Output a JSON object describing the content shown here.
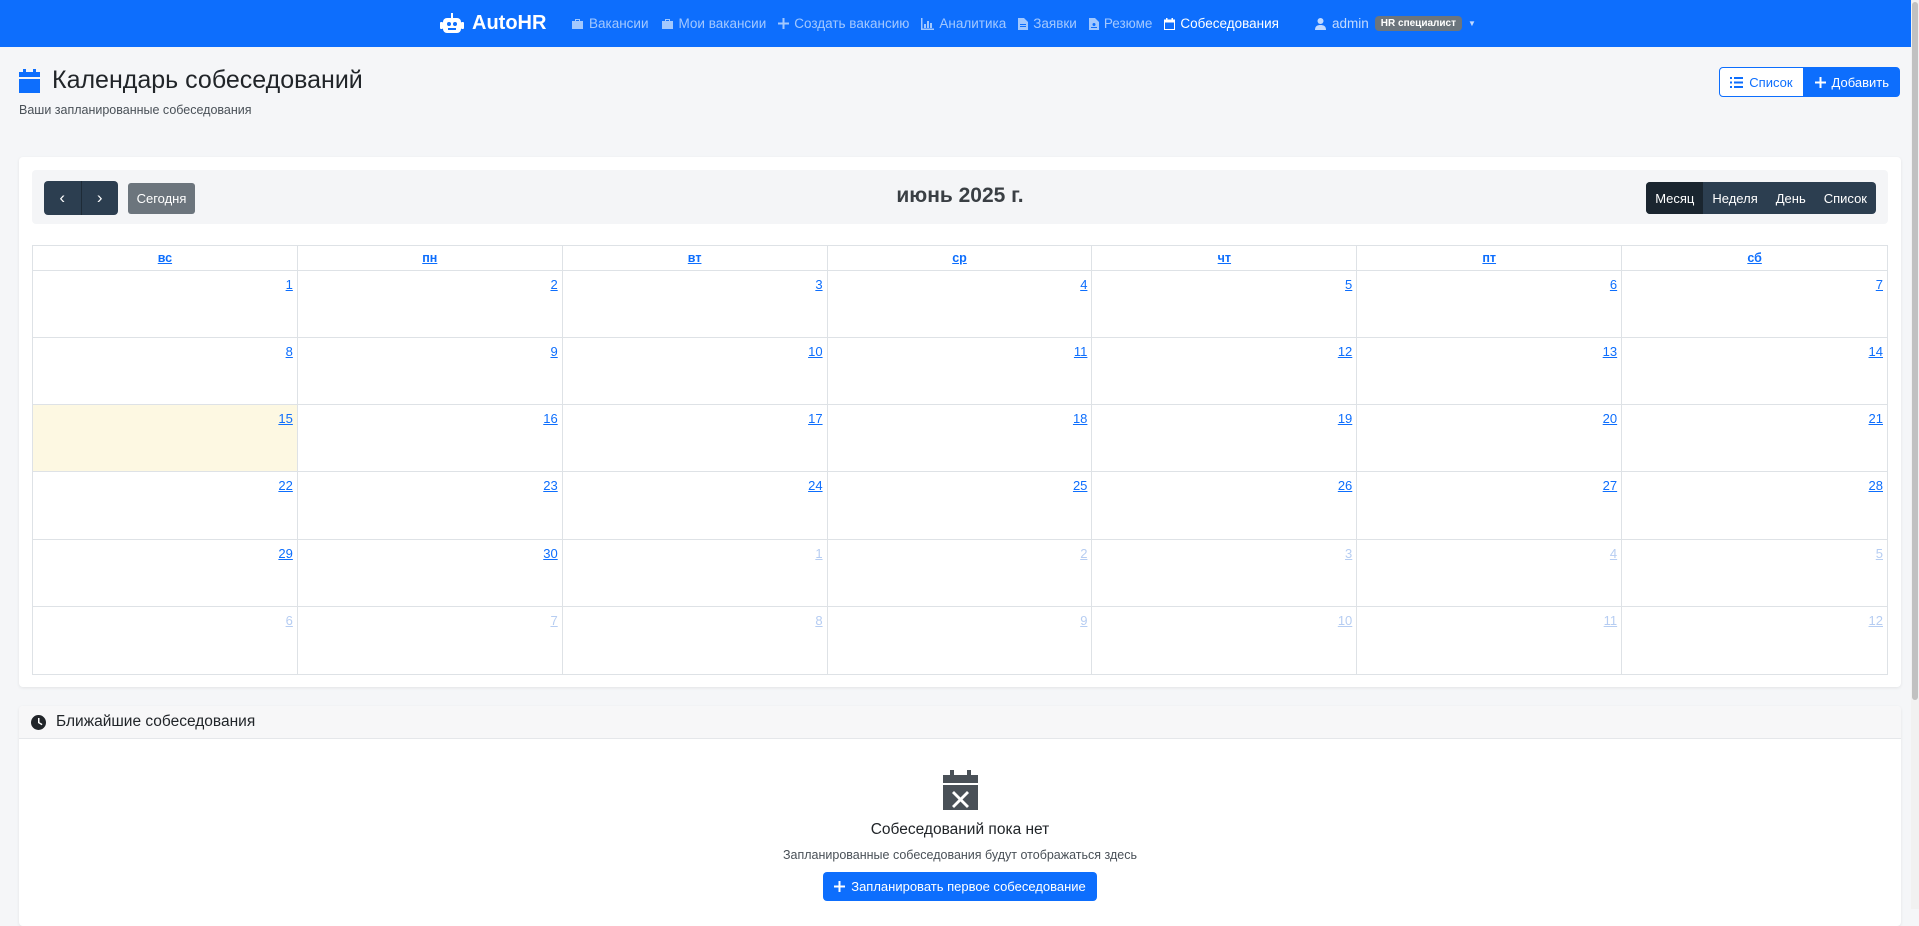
{
  "navbar": {
    "brand": "AutoHR",
    "items": [
      {
        "label": "Вакансии",
        "icon": "briefcase-icon",
        "active": false
      },
      {
        "label": "Мои вакансии",
        "icon": "briefcase-icon",
        "active": false
      },
      {
        "label": "Создать вакансию",
        "icon": "plus-icon",
        "active": false
      },
      {
        "label": "Аналитика",
        "icon": "chart-icon",
        "active": false
      },
      {
        "label": "Заявки",
        "icon": "file-icon",
        "active": false
      },
      {
        "label": "Резюме",
        "icon": "file-user-icon",
        "active": false
      },
      {
        "label": "Собеседования",
        "icon": "calendar-icon",
        "active": true
      }
    ],
    "user": {
      "name": "admin",
      "role": "HR специалист"
    }
  },
  "header": {
    "title": "Календарь собеседований",
    "subtitle": "Ваши запланированные собеседования",
    "list_button": "Список",
    "add_button": "Добавить"
  },
  "calendar": {
    "today_label": "Сегодня",
    "month_title": "июнь 2025 г.",
    "views": [
      "Месяц",
      "Неделя",
      "День",
      "Список"
    ],
    "active_view": "Месяц",
    "weekdays": [
      "вс",
      "пн",
      "вт",
      "ср",
      "чт",
      "пт",
      "сб"
    ],
    "weeks": [
      [
        "1",
        "2",
        "3",
        "4",
        "5",
        "6",
        "7"
      ],
      [
        "8",
        "9",
        "10",
        "11",
        "12",
        "13",
        "14"
      ],
      [
        "15",
        "16",
        "17",
        "18",
        "19",
        "20",
        "21"
      ],
      [
        "22",
        "23",
        "24",
        "25",
        "26",
        "27",
        "28"
      ],
      [
        "29",
        "30",
        "1",
        "2",
        "3",
        "4",
        "5"
      ],
      [
        "6",
        "7",
        "8",
        "9",
        "10",
        "11",
        "12"
      ]
    ],
    "today": "15"
  },
  "upcoming": {
    "title": "Ближайшие собеседования",
    "empty_title": "Собеседований пока нет",
    "empty_text": "Запланированные собеседования будут отображаться здесь",
    "plan_button": "Запланировать первое собеседование"
  },
  "colors": {
    "primary": "#0d6efd",
    "dark": "#2c3e50",
    "today_bg": "#fdf8e2"
  }
}
